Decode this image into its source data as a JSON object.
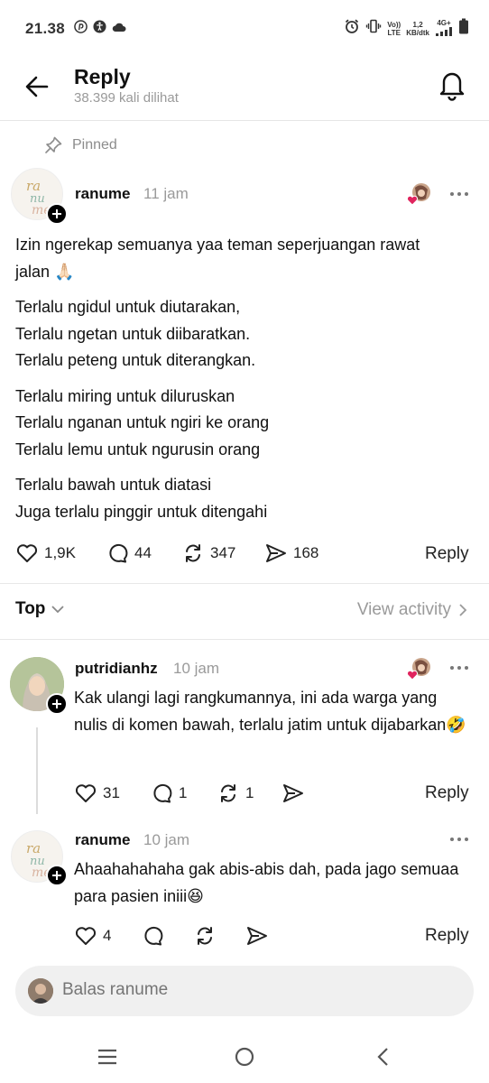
{
  "status": {
    "time": "21.38",
    "volte_top": "Vo))",
    "volte_bottom": "LTE",
    "speed_top": "1,2",
    "speed_bottom": "KB/dtk",
    "network": "4G+"
  },
  "header": {
    "title": "Reply",
    "views": "38.399 kali dilihat"
  },
  "pinned_label": "Pinned",
  "post": {
    "username": "ranume",
    "time": "11 jam",
    "paragraphs": [
      "Izin ngerekap semuanya yaa teman seperjuangan rawat jalan 🙏🏻",
      "Terlalu ngidul untuk diutarakan,\nTerlalu ngetan untuk diibaratkan.\nTerlalu peteng untuk diterangkan.",
      "Terlalu miring untuk diluruskan\nTerlalu nganan untuk ngiri ke orang\nTerlalu lemu untuk ngurusin orang",
      "Terlalu bawah untuk diatasi\nJuga terlalu pinggir untuk ditengahi"
    ],
    "likes": "1,9K",
    "comments": "44",
    "reposts": "347",
    "shares": "168",
    "reply_label": "Reply"
  },
  "sort": {
    "label": "Top",
    "view_activity": "View activity"
  },
  "comments": [
    {
      "username": "putridianhz",
      "time": "10 jam",
      "text": "Kak ulangi lagi rangkumannya, ini ada warga yang nulis di komen bawah, terlalu jatim untuk dijabarkan🤣",
      "likes": "31",
      "comments": "1",
      "reposts": "1",
      "reply_label": "Reply"
    },
    {
      "username": "ranume",
      "time": "10 jam",
      "text": "Ahaahahahaha gak abis-abis dah, pada jago semuaa para pasien iniii😆",
      "likes": "4",
      "reply_label": "Reply"
    }
  ],
  "reply_box": {
    "placeholder": "Balas ranume"
  },
  "colors": {
    "text": "#111111",
    "muted": "#9a9a9a",
    "divider": "#e8e8e8",
    "heart_red": "#e0245e",
    "input_bg": "#f0f0f0"
  },
  "icons": {
    "back": "arrow-left-icon",
    "bell": "bell-icon",
    "pin": "pin-icon",
    "heart": "heart-icon",
    "comment": "comment-icon",
    "repost": "repost-icon",
    "share": "share-icon",
    "more": "more-dots-icon",
    "chevron": "chevron-down-icon"
  }
}
